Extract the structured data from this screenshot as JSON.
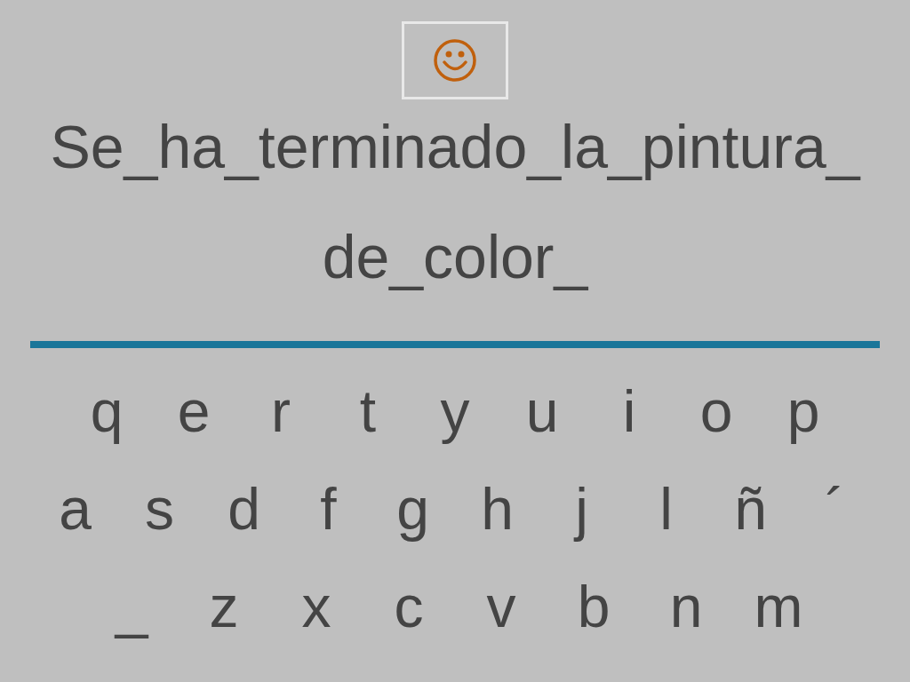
{
  "status": {
    "kind": "happy"
  },
  "sentence_lines": [
    "Se_ha_terminado_la_pintura_",
    "de_color_"
  ],
  "keyboard_rows": [
    [
      "q",
      "e",
      "r",
      "t",
      "y",
      "u",
      "i",
      "o",
      "p"
    ],
    [
      "a",
      "s",
      "d",
      "f",
      "g",
      "h",
      "j",
      "l",
      "ñ",
      "´"
    ],
    [
      "_",
      "z",
      "x",
      "c",
      "v",
      "b",
      "n",
      "m"
    ]
  ]
}
